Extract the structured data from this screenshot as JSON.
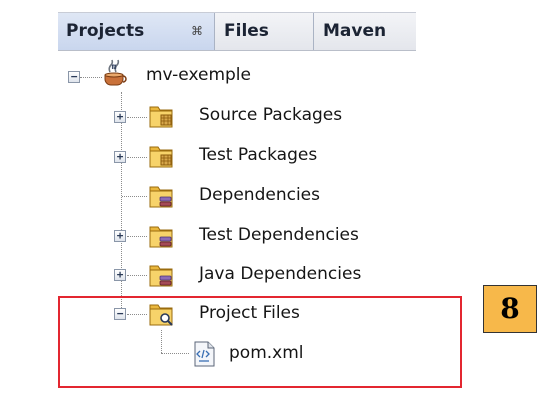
{
  "tabs": [
    {
      "label": "Projects",
      "close": "⌘"
    },
    {
      "label": "Files"
    },
    {
      "label": "Maven"
    }
  ],
  "tree": {
    "root": {
      "label": "mv-exemple",
      "icon": "maven-project-icon"
    },
    "nodes": [
      {
        "label": "Source Packages",
        "icon": "source-packages-folder-icon",
        "expandable": true
      },
      {
        "label": "Test Packages",
        "icon": "test-packages-folder-icon",
        "expandable": true
      },
      {
        "label": "Dependencies",
        "icon": "dependencies-folder-icon",
        "expandable": false
      },
      {
        "label": "Test Dependencies",
        "icon": "test-dependencies-folder-icon",
        "expandable": true
      },
      {
        "label": "Java Dependencies",
        "icon": "java-dependencies-folder-icon",
        "expandable": true
      },
      {
        "label": "Project Files",
        "icon": "project-files-folder-icon",
        "expandable": true,
        "expanded": true,
        "children": [
          {
            "label": "pom.xml",
            "icon": "xml-file-icon"
          }
        ]
      }
    ]
  },
  "annotation": {
    "badge": "8",
    "highlight_color": "#e32630",
    "badge_color": "#f7b84a"
  }
}
